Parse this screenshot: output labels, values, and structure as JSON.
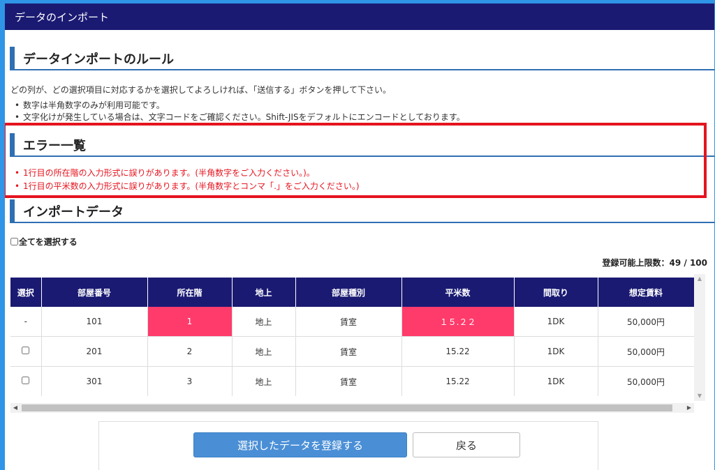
{
  "window": {
    "title": "データのインポート"
  },
  "rules": {
    "heading": "データインポートのルール",
    "intro": "どの列が、どの選択項目に対応するかを選択してよろしければ、「送信する」ボタンを押して下さい。",
    "bullets": [
      "数字は半角数字のみが利用可能です。",
      "文字化けが発生している場合は、文字コードをご確認ください。Shift-JISをデフォルトにエンコードとしております。"
    ]
  },
  "errors": {
    "heading": "エラー一覧",
    "items": [
      "1行目の所在階の入力形式に誤りがあります。(半角数字をご入力ください。)。",
      "1行目の平米数の入力形式に誤りがあります。(半角数字とコンマ「.」をご入力ください。)"
    ],
    "border_color": "#e5141e"
  },
  "import": {
    "heading": "インポートデータ",
    "select_all_label": "全てを選択する",
    "limit_label": "登録可能上限数：49 / 100"
  },
  "table": {
    "columns": [
      "選択",
      "部屋番号",
      "所在階",
      "地上",
      "部屋種別",
      "平米数",
      "間取り",
      "想定賃料"
    ],
    "rows": [
      {
        "select": "-",
        "cells": [
          "101",
          "1",
          "地上",
          "賃室",
          "１５.２２",
          "1DK",
          "50,000円"
        ],
        "error_cols": [
          1,
          4
        ]
      },
      {
        "select": "checkbox",
        "cells": [
          "201",
          "2",
          "地上",
          "賃室",
          "15.22",
          "1DK",
          "50,000円"
        ],
        "error_cols": []
      },
      {
        "select": "checkbox",
        "cells": [
          "301",
          "3",
          "地上",
          "賃室",
          "15.22",
          "1DK",
          "50,000円"
        ],
        "error_cols": []
      }
    ],
    "header_color": "#1a1a73",
    "error_cell_color": "#ff3b6b"
  },
  "actions": {
    "register_label": "選択したデータを登録する",
    "back_label": "戻る"
  },
  "colors": {
    "accent": "#2f6fb3",
    "title_bar": "#1a1a73",
    "primary_button": "#4a8fd6"
  }
}
